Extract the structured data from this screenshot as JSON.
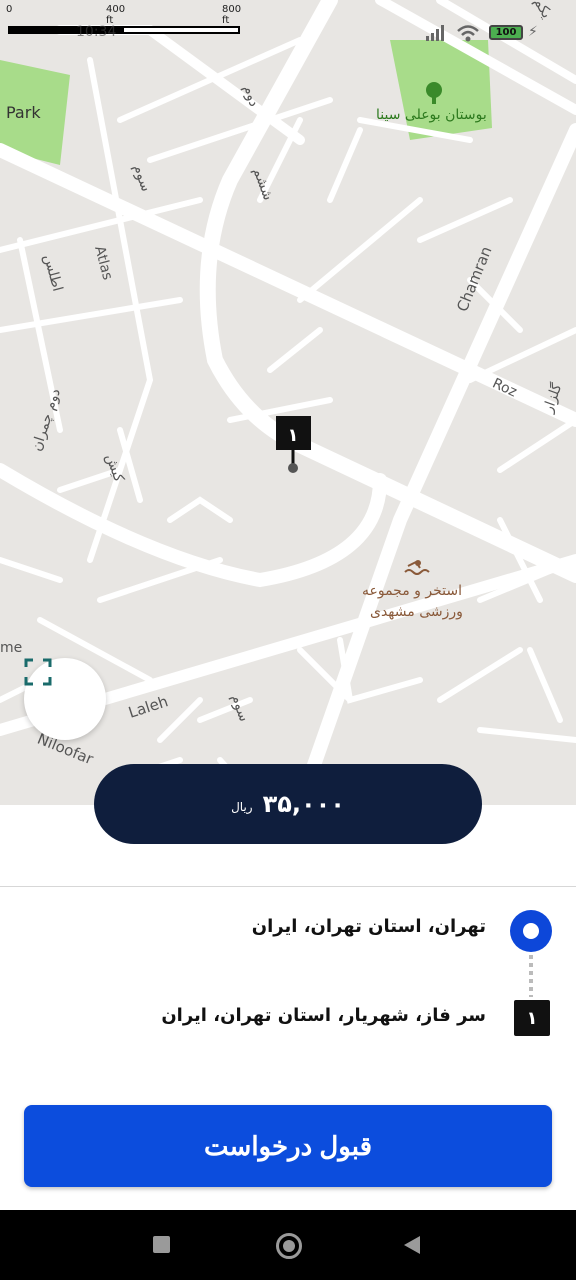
{
  "status_bar": {
    "time": "10:34",
    "battery": "100",
    "scale_labels": [
      "0",
      "400 ft",
      "800 ft"
    ]
  },
  "map": {
    "labels": {
      "park": "Park",
      "bou_ali_park": "بوستان بوعلی سینا",
      "chamran": "Chamran",
      "roz": "Roz",
      "golzar": "گلزار",
      "atlas": "Atlas",
      "atlas_fa": "اطلس",
      "dovvom_1": "دوم",
      "sevvom_1": "سوم",
      "sheshom": "ششم",
      "dovvom_chamran": "دوم چمران",
      "kish": "کیش",
      "laleh": "Laleh",
      "niloofar": "Niloofar",
      "sevvom_2": "سوم",
      "home_partial": "me",
      "pool_line1": "استخر و مجموعه",
      "pool_line2": "ورزشی مشهدی",
      "top_right_partial": "یکم"
    },
    "destination_marker": "۱"
  },
  "price": {
    "value": "۳۵,۰۰۰",
    "unit": "ریال"
  },
  "route": {
    "origin": "تهران، استان تهران، ایران",
    "destination_number": "۱",
    "destination": "سر فاز، شهریار، استان تهران، ایران"
  },
  "actions": {
    "accept_label": "قبول درخواست"
  },
  "colors": {
    "primary": "#0c4ddd",
    "pill": "#0f1e3d",
    "map_bg": "#e8e6e3",
    "park_green": "#a8dc8a"
  }
}
